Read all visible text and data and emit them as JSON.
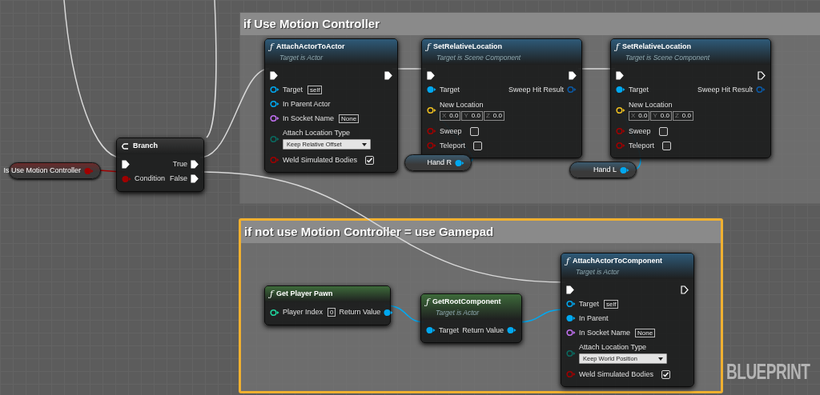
{
  "comments": [
    {
      "title": "if Use Motion Controller",
      "selected": false
    },
    {
      "title": "if not use Motion Controller = use Gamepad",
      "selected": true
    }
  ],
  "nodes": [
    {
      "kind": "variable",
      "title": "Is Use Motion Controller",
      "pin": {
        "kind": "bool",
        "connected": true
      }
    },
    {
      "kind": "branch",
      "title": "Branch",
      "color": "#3a3a3a",
      "exec_in": {
        "connected": true
      },
      "exec_out": {
        "label": "True",
        "connected": true
      },
      "inputs": [
        {
          "label": "Condition",
          "kind": "bool",
          "connected": true
        }
      ],
      "outputs": [
        {
          "label": "False",
          "kind": "exec",
          "connected": true
        }
      ]
    },
    {
      "kind": "function",
      "icon": "ƒ",
      "title": "AttachActorToActor",
      "subtitle": "Target is Actor",
      "color": "#2e5a78",
      "exec_in": {
        "connected": true
      },
      "exec_out": {
        "connected": true
      },
      "inputs": [
        {
          "label": "Target",
          "kind": "object",
          "connected": false,
          "value": "self"
        },
        {
          "label": "In Parent Actor",
          "kind": "object",
          "connected": false
        },
        {
          "label": "In Socket Name",
          "kind": "name",
          "connected": false,
          "value": "None"
        },
        {
          "label": "Attach Location Type",
          "kind": "enum",
          "connected": false,
          "option": "Keep Relative Offset"
        },
        {
          "label": "Weld Simulated Bodies",
          "kind": "bool",
          "connected": false,
          "checked": true
        }
      ]
    },
    {
      "kind": "function",
      "icon": "ƒ",
      "title": "SetRelativeLocation",
      "subtitle": "Target is Scene Component",
      "color": "#2e5a78",
      "exec_in": {
        "connected": true
      },
      "exec_out": {
        "connected": true
      },
      "inputs": [
        {
          "label": "Target",
          "kind": "object",
          "connected": true
        },
        {
          "label": "New Location",
          "kind": "vector",
          "connected": false,
          "components": [
            {
              "axis": "X",
              "value": "0.0"
            },
            {
              "axis": "Y",
              "value": "0.0"
            },
            {
              "axis": "Z",
              "value": "0.0"
            }
          ]
        },
        {
          "label": "Sweep",
          "kind": "bool",
          "connected": false,
          "checked": false
        },
        {
          "label": "Teleport",
          "kind": "bool",
          "connected": false,
          "checked": false
        }
      ],
      "outputs": [
        {
          "label": "Sweep Hit Result",
          "kind": "struct",
          "connected": false
        }
      ]
    },
    {
      "kind": "function",
      "icon": "ƒ",
      "title": "SetRelativeLocation",
      "subtitle": "Target is Scene Component",
      "color": "#2e5a78",
      "exec_in": {
        "connected": true
      },
      "exec_out": {
        "connected": false
      },
      "inputs": [
        {
          "label": "Target",
          "kind": "object",
          "connected": true
        },
        {
          "label": "New Location",
          "kind": "vector",
          "connected": false,
          "components": [
            {
              "axis": "X",
              "value": "0.0"
            },
            {
              "axis": "Y",
              "value": "0.0"
            },
            {
              "axis": "Z",
              "value": "0.0"
            }
          ]
        },
        {
          "label": "Sweep",
          "kind": "bool",
          "connected": false,
          "checked": false
        },
        {
          "label": "Teleport",
          "kind": "bool",
          "connected": false,
          "checked": false
        }
      ],
      "outputs": [
        {
          "label": "Sweep Hit Result",
          "kind": "struct",
          "connected": false
        }
      ]
    },
    {
      "kind": "variable",
      "title": "Hand R",
      "pin": {
        "kind": "object",
        "connected": true
      }
    },
    {
      "kind": "variable",
      "title": "Hand L",
      "pin": {
        "kind": "object",
        "connected": true
      }
    },
    {
      "kind": "function",
      "icon": "ƒ",
      "title": "Get Player Pawn",
      "color": "#3d6a3a",
      "inputs": [
        {
          "label": "Player Index",
          "kind": "int",
          "connected": false,
          "value": "0"
        }
      ],
      "outputs": [
        {
          "label": "Return Value",
          "kind": "object",
          "connected": true
        }
      ]
    },
    {
      "kind": "function",
      "icon": "ƒ",
      "title": "GetRootComponent",
      "subtitle": "Target is Actor",
      "color": "#3d6a3a",
      "inputs": [
        {
          "label": "Target",
          "kind": "object",
          "connected": true
        }
      ],
      "outputs": [
        {
          "label": "Return Value",
          "kind": "object",
          "connected": true
        }
      ]
    },
    {
      "kind": "function",
      "icon": "ƒ",
      "title": "AttachActorToComponent",
      "subtitle": "Target is Actor",
      "color": "#2e5a78",
      "exec_in": {
        "connected": true
      },
      "exec_out": {
        "connected": false
      },
      "inputs": [
        {
          "label": "Target",
          "kind": "object",
          "connected": false,
          "value": "self"
        },
        {
          "label": "In Parent",
          "kind": "object",
          "connected": true
        },
        {
          "label": "In Socket Name",
          "kind": "name",
          "connected": false,
          "value": "None"
        },
        {
          "label": "Attach Location Type",
          "kind": "enum",
          "connected": false,
          "option": "Keep World Position"
        },
        {
          "label": "Weld Simulated Bodies",
          "kind": "bool",
          "connected": false,
          "checked": true
        }
      ]
    }
  ],
  "graph_label": "BLUEPRINT"
}
